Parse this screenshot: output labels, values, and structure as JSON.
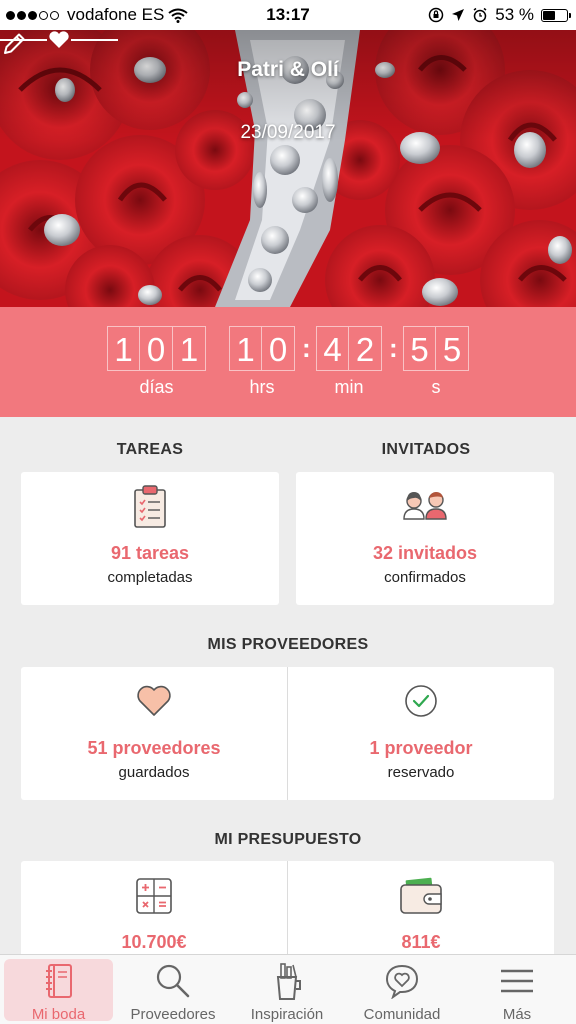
{
  "status_bar": {
    "carrier": "vodafone ES",
    "time": "13:17",
    "battery": "53 %",
    "battery_level": 0.53
  },
  "header": {
    "couple_names": "Patri & Olí",
    "wedding_date": "23/09/2017",
    "edit_icon": "pencil-icon"
  },
  "countdown": {
    "days_digits": [
      "1",
      "0",
      "1"
    ],
    "hours_digits": [
      "1",
      "0"
    ],
    "minutes_digits": [
      "4",
      "2"
    ],
    "seconds_digits": [
      "5",
      "5"
    ],
    "labels": {
      "days": "días",
      "hours": "hrs",
      "minutes": "min",
      "seconds": "s"
    },
    "background_color": "#f2787e"
  },
  "tasks": {
    "title": "TAREAS",
    "count": "91 tareas",
    "caption": "completadas",
    "icon": "clipboard-checklist-icon"
  },
  "guests": {
    "title": "INVITADOS",
    "count": "32 invitados",
    "caption": "confirmados",
    "icon": "guests-icon"
  },
  "vendors": {
    "title": "MIS PROVEEDORES",
    "saved_count": "51 proveedores",
    "saved_caption": "guardados",
    "saved_icon": "heart-icon",
    "booked_count": "1 proveedor",
    "booked_caption": "reservado",
    "booked_icon": "check-circle-icon"
  },
  "budget": {
    "title": "MI PRESUPUESTO",
    "estimated": "10.700€",
    "estimated_icon": "calculator-icon",
    "spent": "811€",
    "spent_icon": "wallet-icon"
  },
  "tab_bar": {
    "items": [
      {
        "label": "Mi boda",
        "icon": "notebook-icon",
        "active": true
      },
      {
        "label": "Proveedores",
        "icon": "search-icon",
        "active": false
      },
      {
        "label": "Inspiración",
        "icon": "inspiration-icon",
        "active": false
      },
      {
        "label": "Comunidad",
        "icon": "community-heart-icon",
        "active": false
      },
      {
        "label": "Más",
        "icon": "menu-icon",
        "active": false
      }
    ]
  },
  "colors": {
    "accent": "#e9686f",
    "active_tab_bg": "#f7d9dc"
  }
}
